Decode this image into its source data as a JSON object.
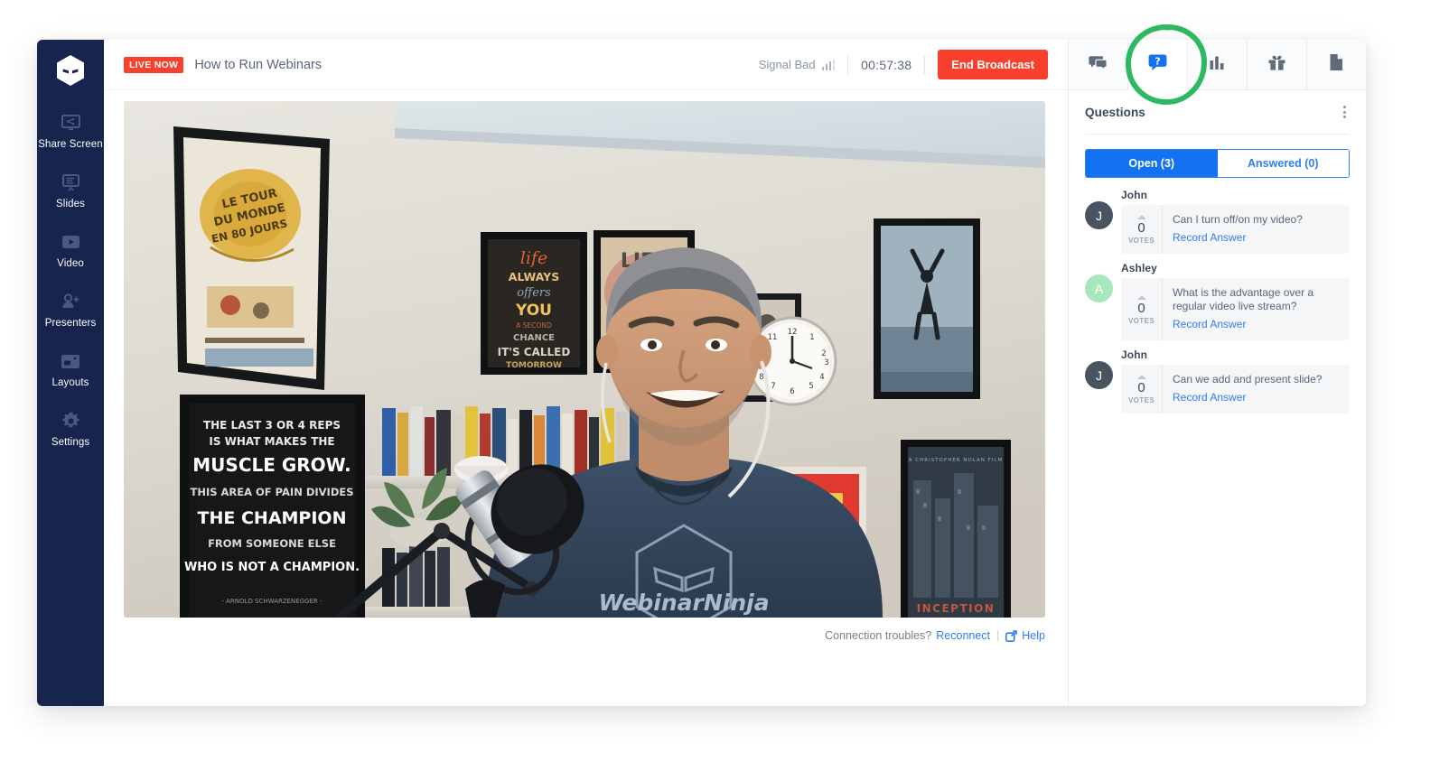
{
  "sidebar": {
    "logo_name": "webinarninja-logo",
    "items": [
      {
        "label": "Share Screen",
        "icon": "share-screen-icon"
      },
      {
        "label": "Slides",
        "icon": "slides-icon"
      },
      {
        "label": "Video",
        "icon": "video-icon"
      },
      {
        "label": "Presenters",
        "icon": "presenters-icon"
      },
      {
        "label": "Layouts",
        "icon": "layouts-icon"
      },
      {
        "label": "Settings",
        "icon": "settings-gear-icon"
      }
    ]
  },
  "topbar": {
    "live_badge": "LIVE NOW",
    "title": "How to Run Webinars",
    "signal_label": "Signal Bad",
    "signal_icon": "signal-bars-icon",
    "timer": "00:57:38",
    "end_broadcast_label": "End Broadcast"
  },
  "stage": {
    "footer_prompt": "Connection troubles?",
    "reconnect_label": "Reconnect",
    "help_label": "Help",
    "help_icon": "external-link-icon"
  },
  "panel": {
    "tabs": [
      {
        "name": "chat",
        "icon": "chat-bubbles-icon",
        "active": false
      },
      {
        "name": "questions",
        "icon": "question-bubble-icon",
        "active": true
      },
      {
        "name": "polls",
        "icon": "bar-chart-icon",
        "active": false
      },
      {
        "name": "offers",
        "icon": "gift-icon",
        "active": false
      },
      {
        "name": "handouts",
        "icon": "document-icon",
        "active": false
      }
    ],
    "title": "Questions",
    "menu_icon": "kebab-menu-icon",
    "segments": [
      {
        "label": "Open (3)",
        "active": true
      },
      {
        "label": "Answered (0)",
        "active": false
      }
    ],
    "questions": [
      {
        "author": "John",
        "initial": "J",
        "avatar_color": "#4a5360",
        "votes": "0",
        "votes_label": "VOTES",
        "text": "Can I turn off/on my video?",
        "action": "Record Answer"
      },
      {
        "author": "Ashley",
        "initial": "A",
        "avatar_color": "#a8e6bd",
        "votes": "0",
        "votes_label": "VOTES",
        "text": "What is the advantage over a regular video live stream?",
        "action": "Record Answer"
      },
      {
        "author": "John",
        "initial": "J",
        "avatar_color": "#4a5360",
        "votes": "0",
        "votes_label": "VOTES",
        "text": "Can we add and present slide?",
        "action": "Record Answer"
      }
    ]
  },
  "annotation": {
    "name": "green-circle-highlight",
    "color": "#2fb862",
    "target": "questions-tab"
  },
  "colors": {
    "sidebar_bg": "#16244e",
    "accent_red": "#f8402c",
    "accent_blue": "#1272f0",
    "link_blue": "#2f7df6",
    "annotation_green": "#2fb862"
  }
}
